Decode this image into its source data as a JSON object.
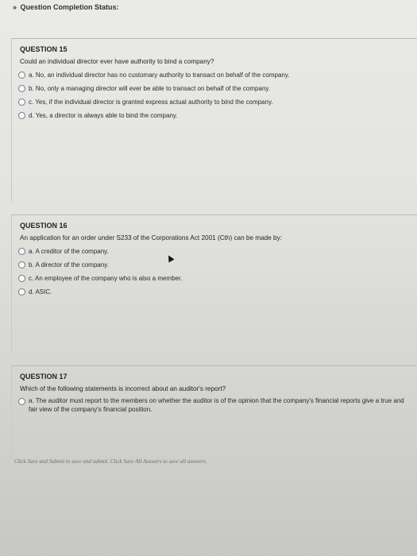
{
  "header": {
    "chevron": "»",
    "title": "Question Completion Status:"
  },
  "questions": [
    {
      "heading": "QUESTION 15",
      "text": "Could an individual director ever have authority to bind a company?",
      "options": [
        "a. No, an individual director has no customary authority to transact on behalf of the company.",
        "b. No, only a managing director will ever be able to transact on behalf of the company.",
        "c. Yes, if the individual director is granted express actual authority to bind the company.",
        "d. Yes, a director is always able to bind the company."
      ]
    },
    {
      "heading": "QUESTION 16",
      "text": "An application for an order under S233 of the Corporations Act 2001 (Cth) can be made by:",
      "options": [
        "a. A creditor of the company.",
        "b. A director of the company.",
        "c. An employee of the company who is also a member.",
        "d. ASIC."
      ]
    },
    {
      "heading": "QUESTION 17",
      "text": "Which of the following statements is incorrect about an auditor's report?",
      "options": [
        "a. The auditor must report to the members on whether the auditor is of the opinion that the company's financial reports give a true and fair view of the company's financial position."
      ]
    }
  ],
  "footer": "Click Save and Submit to save and submit. Click Save All Answers to save all answers."
}
